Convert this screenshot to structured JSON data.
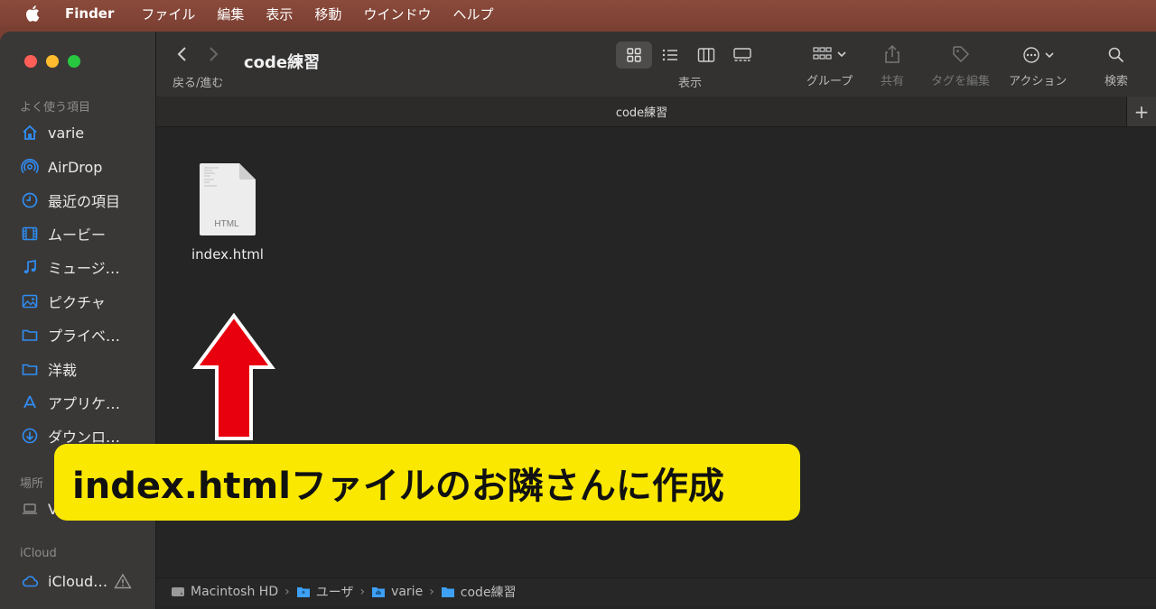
{
  "menubar": {
    "app": "Finder",
    "items": [
      "ファイル",
      "編集",
      "表示",
      "移動",
      "ウインドウ",
      "ヘルプ"
    ]
  },
  "sidebar": {
    "favorites_label": "よく使う項目",
    "favorites": [
      {
        "label": "varie",
        "icon": "home-icon"
      },
      {
        "label": "AirDrop",
        "icon": "airdrop-icon"
      },
      {
        "label": "最近の項目",
        "icon": "clock-icon"
      },
      {
        "label": "ムービー",
        "icon": "film-icon"
      },
      {
        "label": "ミュージ…",
        "icon": "music-icon"
      },
      {
        "label": "ピクチャ",
        "icon": "photo-icon"
      },
      {
        "label": "プライベ…",
        "icon": "folder-icon"
      },
      {
        "label": "洋裁",
        "icon": "folder-icon"
      },
      {
        "label": "アプリケ…",
        "icon": "apps-icon"
      },
      {
        "label": "ダウンロ…",
        "icon": "download-icon"
      }
    ],
    "locations_label": "場所",
    "locations_item": "V",
    "icloud_label": "iCloud",
    "icloud_item": "iCloud…"
  },
  "toolbar": {
    "back_forward_label": "戻る/進む",
    "title": "code練習",
    "view_label": "表示",
    "group_label": "グループ",
    "share_label": "共有",
    "tags_label": "タグを編集",
    "action_label": "アクション",
    "search_label": "検索"
  },
  "tab": {
    "title": "code練習",
    "add": "+"
  },
  "files": [
    {
      "name": "index.html",
      "type_badge": "HTML"
    }
  ],
  "banner": {
    "text": "index.htmlファイルのお隣さんに作成"
  },
  "pathbar": [
    "Macintosh HD",
    "ユーザ",
    "varie",
    "code練習"
  ],
  "colors": {
    "accent": "#2f8ef5",
    "banner": "#fbe800",
    "arrow": "#e8000e"
  }
}
